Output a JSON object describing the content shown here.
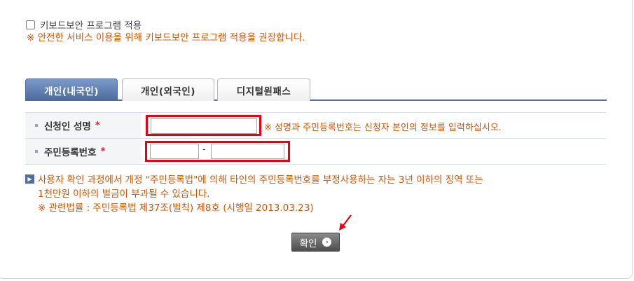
{
  "keyboard_security": {
    "checkbox_label": "키보드보안 프로그램 적용",
    "checked": false,
    "note": "※ 안전한 서비스 이용을 위해 키보드보안 프로그램 적용을 권장합니다."
  },
  "tabs": [
    {
      "label": "개인(내국인)",
      "active": true
    },
    {
      "label": "개인(외국인)",
      "active": false
    },
    {
      "label": "디지털원패스",
      "active": false
    }
  ],
  "form": {
    "name_label": "신청인 성명",
    "name_required": "*",
    "name_value": "",
    "name_note": "※ 성명과 주민등록번호는 신청자 본인의 정보를 입력하십시오.",
    "rrn_label": "주민등록번호",
    "rrn_required": "*",
    "rrn_front_value": "",
    "rrn_back_value": "",
    "rrn_separator": "-"
  },
  "notice": {
    "line1": "사용자 확인 과정에서 개정 \"주민등록법\"에 의해 타인의 주민등록번호를 부정사용하는 자는 3년 이하의 징역 또는",
    "line2": "1천만원 이하의 벌금이 부과될 수 있습니다.",
    "line3": "※ 관련법률 : 주민등록법 제37조(벌칙) 제8호 (시행일 2013.03.23)"
  },
  "confirm_button": {
    "label": "확인",
    "arrow_icon": "chevron-right-icon"
  },
  "colors": {
    "accent_orange": "#d35400",
    "tab_active": "#4a6a9c",
    "highlight_red": "#e60012",
    "required_red": "#d9232a"
  }
}
